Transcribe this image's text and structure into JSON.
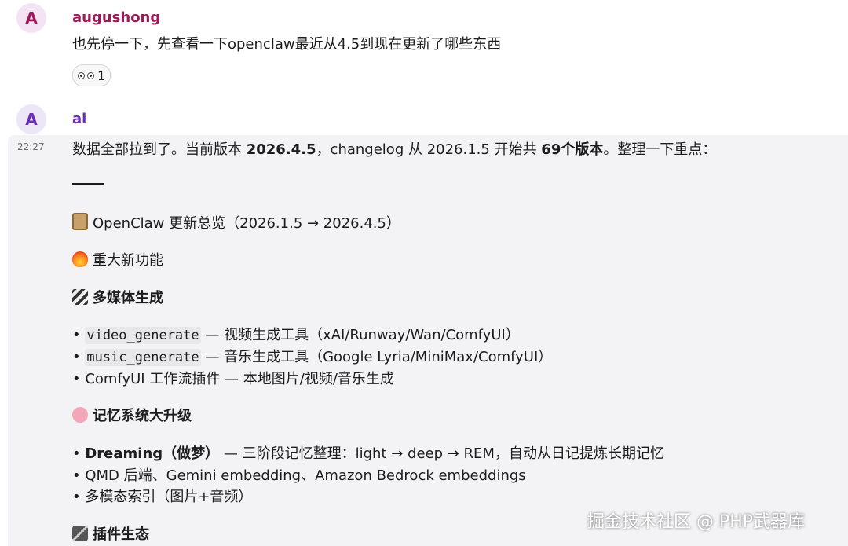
{
  "messages": [
    {
      "avatar": "A",
      "username": "augushong",
      "text": "也先停一下，先查看一下openclaw最近从4.5到现在更新了哪些东西",
      "reaction": {
        "icon": "eyes-icon",
        "count": "1"
      }
    },
    {
      "avatar": "A",
      "username": "ai",
      "time": "22:27",
      "intro": {
        "p1": "数据全部拉到了。当前版本 ",
        "b1": "2026.4.5",
        "p2": "，changelog 从 2026.1.5 开始共 ",
        "b2": "69个版本",
        "p3": "。整理一下重点："
      },
      "overview": "OpenClaw 更新总览（2026.1.5 → 2026.4.5）",
      "major": "重大新功能",
      "sections": {
        "media": {
          "title": "多媒体生成",
          "items": [
            {
              "code": "video_generate",
              "text": " — 视频生成工具（xAI/Runway/Wan/ComfyUI）"
            },
            {
              "code": "music_generate",
              "text": " — 音乐生成工具（Google Lyria/MiniMax/ComfyUI）"
            },
            {
              "text": "ComfyUI 工作流插件 — 本地图片/视频/音乐生成"
            }
          ]
        },
        "memory": {
          "title": "记忆系统大升级",
          "items": [
            {
              "bold": "Dreaming（做梦）",
              "text": " — 三阶段记忆整理：light → deep → REM，自动从日记提炼长期记忆"
            },
            {
              "text": "QMD 后端、Gemini embedding、Amazon Bedrock embeddings"
            },
            {
              "text": "多模态索引（图片+音频）"
            }
          ]
        },
        "plugins": {
          "title": "插件生态"
        }
      }
    }
  ],
  "watermark": "掘金技术社区 @ PHP武器库",
  "colors": {
    "user1": "#9b1b5a",
    "user2": "#6a2fb5",
    "hover": "#f3f3f5"
  }
}
